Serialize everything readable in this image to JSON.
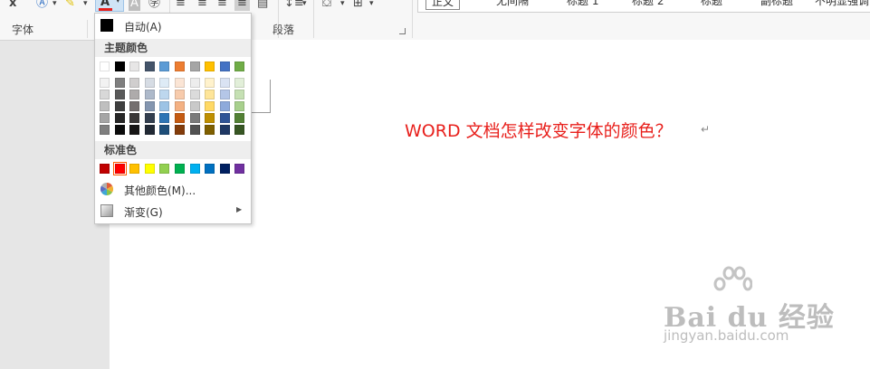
{
  "ribbon": {
    "font_group_label": "字体",
    "paragraph_group_label": "段落",
    "styles": [
      "正文",
      "无间隔",
      "标题 1",
      "标题 2",
      "标题",
      "副标题",
      "不明显强调"
    ]
  },
  "document": {
    "text": "WORD  文档怎样改变字体的颜色？",
    "paragraph_mark": "↵"
  },
  "watermark": {
    "brand": "Bai du 经验",
    "url": "jingyan.baidu.com"
  },
  "color_menu": {
    "auto_label": "自动(A)",
    "theme_colors_title": "主题颜色",
    "theme_colors": [
      [
        "#ffffff",
        "#f2f2f2",
        "#d8d8d8",
        "#bfbfbf",
        "#a5a5a5",
        "#7f7f7f"
      ],
      [
        "#000000",
        "#7f7f7f",
        "#595959",
        "#3f3f3f",
        "#262626",
        "#0c0c0c"
      ],
      [
        "#e7e6e6",
        "#d0cece",
        "#aeabab",
        "#757070",
        "#3a3838",
        "#171616"
      ],
      [
        "#44546a",
        "#d6dce4",
        "#adb9ca",
        "#8496b0",
        "#333f4f",
        "#222a35"
      ],
      [
        "#5b9bd5",
        "#deebf6",
        "#bdd7ee",
        "#9cc3e5",
        "#2e75b5",
        "#1e4e79"
      ],
      [
        "#ed7d31",
        "#fbe5d5",
        "#f7cbac",
        "#f4b183",
        "#c55a11",
        "#833c0b"
      ],
      [
        "#a5a5a5",
        "#ededed",
        "#dbdbdb",
        "#c9c9c9",
        "#7b7b7b",
        "#525252"
      ],
      [
        "#ffc000",
        "#fff2cc",
        "#fee599",
        "#ffd965",
        "#bf8f00",
        "#7f5f00"
      ],
      [
        "#4472c4",
        "#dae3f3",
        "#b4c6e7",
        "#8eaadb",
        "#2f5496",
        "#1f3864"
      ],
      [
        "#70ad47",
        "#e2efd9",
        "#c5e0b3",
        "#a8d08d",
        "#538135",
        "#375623"
      ]
    ],
    "standard_colors_title": "标准色",
    "standard_colors": [
      "#c00000",
      "#ff0000",
      "#ffc000",
      "#ffff00",
      "#92d050",
      "#00b050",
      "#00b0f0",
      "#0070c0",
      "#002060",
      "#7030a0"
    ],
    "selected_standard_index": 1,
    "more_colors_label": "其他颜色(M)...",
    "gradient_label": "渐变(G)"
  }
}
